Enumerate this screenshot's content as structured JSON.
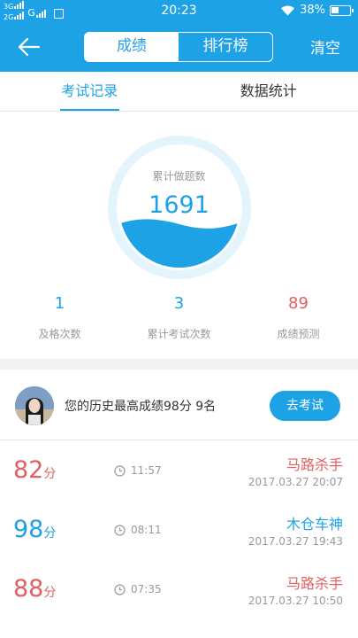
{
  "status_bar": {
    "net1": "3G",
    "net2": "2G",
    "carrier_g": "G",
    "time": "20:23",
    "battery": "38%",
    "icons": [
      "signal-icon",
      "sim-icon",
      "wifi-icon",
      "battery-icon"
    ]
  },
  "header": {
    "tabs": [
      "成绩",
      "排行榜"
    ],
    "active_tab": 0,
    "clear_label": "清空",
    "color": "#1ea2e6"
  },
  "subtabs": [
    "考试记录",
    "数据统计"
  ],
  "gauge": {
    "label": "累计做题数",
    "value": "1691"
  },
  "stats": [
    {
      "value": "1",
      "label": "及格次数"
    },
    {
      "value": "3",
      "label": "累计考试次数"
    },
    {
      "value": "89",
      "label": "成绩预测"
    }
  ],
  "best": {
    "text": "您的历史最高成绩98分  9名",
    "button": "去考试"
  },
  "records": [
    {
      "score": "82",
      "unit": "分",
      "duration": "11:57",
      "title": "马路杀手",
      "date": "2017.03.27  20:07",
      "color": "#e06060"
    },
    {
      "score": "98",
      "unit": "分",
      "duration": "08:11",
      "title": "木仓车神",
      "date": "2017.03.27  19:43",
      "color": "#1ea2e6"
    },
    {
      "score": "88",
      "unit": "分",
      "duration": "07:35",
      "title": "马路杀手",
      "date": "2017.03.27  10:50",
      "color": "#e06060"
    }
  ]
}
